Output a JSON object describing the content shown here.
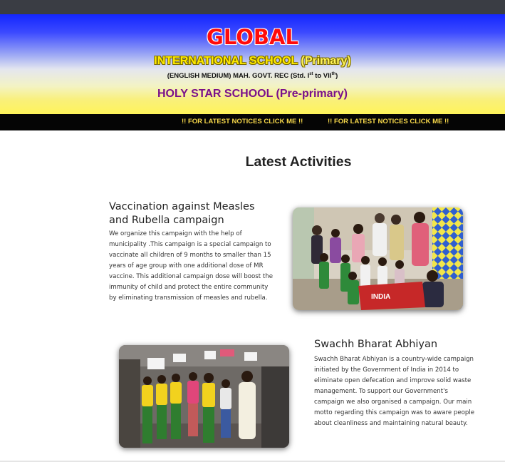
{
  "header": {
    "title_line1": "GLOBAL",
    "title_line2_main": "INTERNATIONAL SCHOOL",
    "title_line2_paren": "(Primary)",
    "medium_prefix": "(ENGLISH MEDIUM) MAH. GOVT. REC (Std. I",
    "medium_sup1": "st",
    "medium_middle": " to VII",
    "medium_sup2": "th",
    "medium_suffix": ")",
    "subtitle": "HOLY STAR SCHOOL (Pre-primary)"
  },
  "notices": {
    "label_1": "!! FOR LATEST NOTICES CLICK ME !!",
    "label_2": "!! FOR LATEST NOTICES CLICK ME !!"
  },
  "section": {
    "heading": "Latest Activities"
  },
  "activities": [
    {
      "title": "Vaccination against Measles and Rubella campaign",
      "description": "We organize this campaign with the help of municipality .This campaign is a special campaign to vaccinate all children of 9 months to smaller than 15 years of age group with one additional dose of MR vaccine. This additional campaign dose will boost the immunity of child and protect the entire community by eliminating transmission of measles and rubella.",
      "photo_banner_text": "INDIA"
    },
    {
      "title": "Swachh Bharat Abhiyan",
      "description": "Swachh Bharat Abhiyan is a country-wide campaign initiated by the Government of India in 2014 to eliminate open defecation and improve solid waste management. To support our Government's campaign we also organised a campaign. Our main motto regarding this campaign was to aware people about cleanliness and maintaining natural beauty."
    }
  ],
  "colors": {
    "hero_top": "#1326ff",
    "hero_bottom": "#fff45a",
    "global_red": "#ff0b0b",
    "intl_yellow": "#ffea00",
    "holystar_purple": "#7a0f8a",
    "notice_text": "#f7d84a",
    "notice_bg": "#050505"
  }
}
